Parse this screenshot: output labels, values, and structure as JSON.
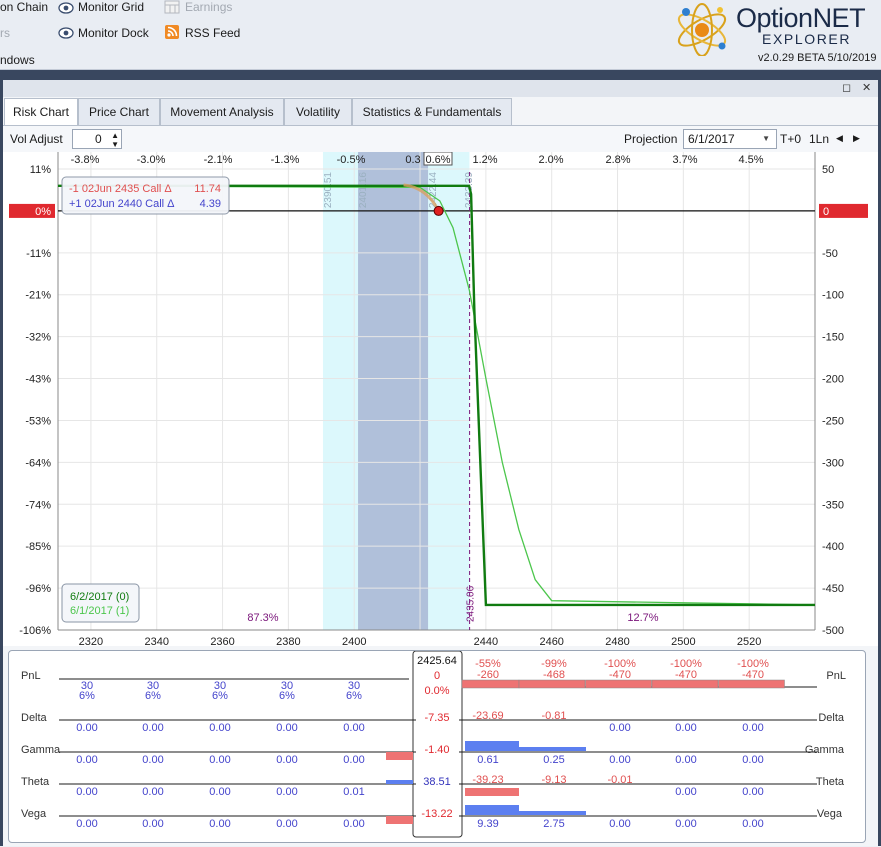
{
  "ribbon": {
    "items": [
      {
        "label": "on Chain",
        "icon": "option-chain-icon",
        "dim": false
      },
      {
        "label": "Monitor Grid",
        "icon": "monitor-grid-icon",
        "dim": false
      },
      {
        "label": "Earnings",
        "icon": "earnings-icon",
        "dim": true
      },
      {
        "label": "rs",
        "icon": "",
        "dim": true
      },
      {
        "label": "Monitor Dock",
        "icon": "monitor-dock-icon",
        "dim": false
      },
      {
        "label": "RSS Feed",
        "icon": "rss-feed-icon",
        "dim": false
      },
      {
        "label": "ndows",
        "icon": "",
        "dim": false
      }
    ],
    "logo": {
      "name_a": "Option",
      "name_b": "NET",
      "name_c": "EXPLORER",
      "version": "v2.0.29 BETA 5/10/2019"
    }
  },
  "window_controls": {
    "restore": "◻",
    "close": "✕"
  },
  "tabs": [
    "Risk Chart",
    "Price Chart",
    "Movement Analysis",
    "Volatility",
    "Statistics & Fundamentals"
  ],
  "toolbar": {
    "vol_adjust_label": "Vol Adjust",
    "vol_adjust_value": "0",
    "projection_label": "Projection",
    "projection_date": "6/1/2017",
    "t_offset": "T+0",
    "lines": "1Ln"
  },
  "colors": {
    "accent_red": "#e0292f",
    "loss_red": "#e05050",
    "gain_blue": "#4444cc",
    "curve_dark_green": "#107b10",
    "curve_light_green": "#4cc64c",
    "band_outer": "#dcf8fc",
    "band_inner": "#b0c0da",
    "sd_label": "#9ab0c0",
    "marker_purple": "#7a157a"
  },
  "chart_data": {
    "type": "line",
    "x_axis": {
      "label": "",
      "min": 2310,
      "max": 2540,
      "ticks": [
        2320,
        2340,
        2360,
        2380,
        2400,
        2420,
        2440,
        2460,
        2480,
        2500,
        2520
      ]
    },
    "top_axis_ticks": [
      "-3.8%",
      "-3.0%",
      "-2.1%",
      "-1.3%",
      "-0.5%",
      "0.3",
      "0.6%",
      "1.2%",
      "2.0%",
      "2.8%",
      "3.7%",
      "4.5%"
    ],
    "top_axis_highlight": "0.6%",
    "left_axis": {
      "ticks": [
        "11%",
        "0%",
        "-11%",
        "-21%",
        "-32%",
        "-43%",
        "-53%",
        "-64%",
        "-74%",
        "-85%",
        "-96%",
        "-106%"
      ]
    },
    "right_axis": {
      "min": -500,
      "max": 50,
      "ticks": [
        "50",
        "0",
        "-50",
        "-100",
        "-150",
        "-200",
        "-250",
        "-300",
        "-350",
        "-400",
        "-450",
        "-500"
      ]
    },
    "zero_label_left": "0%",
    "zero_label_right": "0",
    "sd_bands": {
      "outer": [
        2390.51,
        2435.0
      ],
      "inner": [
        2401.16,
        2422.44
      ],
      "labels": [
        "2390.51",
        "2401.16",
        "2422.44",
        "2433.39"
      ]
    },
    "current_price": 2425.64,
    "break_even": {
      "x": 2435.06,
      "label": "2435.06"
    },
    "prob_left": "87.3%",
    "prob_right": "12.7%",
    "positions": [
      {
        "label": "-1 02Jun 2435 Call  Δ",
        "value": "11.74",
        "color": "#e05050"
      },
      {
        "label": "+1 02Jun 2440 Call  Δ",
        "value": "4.39",
        "color": "#4444cc"
      }
    ],
    "series": [
      {
        "name": "6/2/2017 (0)",
        "color": "#107b10",
        "x": [
          2310,
          2434.9,
          2435.5,
          2436.5,
          2440,
          2540
        ],
        "y": [
          30,
          30,
          20,
          -120,
          -470,
          -470
        ]
      },
      {
        "name": "6/1/2017 (1)",
        "color": "#4cc64c",
        "x": [
          2310,
          2420,
          2426,
          2430,
          2435,
          2440,
          2445,
          2450,
          2455,
          2460,
          2540
        ],
        "y": [
          30,
          28,
          12,
          -20,
          -95,
          -200,
          -300,
          -380,
          -440,
          -465,
          -470
        ]
      }
    ]
  },
  "greeks": {
    "current_label": "2425.64",
    "rows": [
      {
        "name": "PnL",
        "center": "0",
        "center2": "0.0%",
        "center_color": "#e0292f",
        "left_values": [
          "30",
          "30",
          "30",
          "30",
          "30"
        ],
        "left_pcts": [
          "6%",
          "6%",
          "6%",
          "6%",
          "6%"
        ],
        "right_top": [
          "-55%",
          "-99%",
          "-100%",
          "-100%",
          "-100%"
        ],
        "right_values": [
          "-260",
          "-468",
          "-470",
          "-470",
          "-470"
        ]
      },
      {
        "name": "Delta",
        "center": "-7.35",
        "center_color": "#e0292f",
        "left_values": [
          "0.00",
          "0.00",
          "0.00",
          "0.00",
          "0.00"
        ],
        "right_values": [
          "-23.69",
          "-0.81",
          "0.00",
          "0.00",
          "0.00"
        ]
      },
      {
        "name": "Gamma",
        "center": "-1.40",
        "center_color": "#e0292f",
        "left_values": [
          "0.00",
          "0.00",
          "0.00",
          "0.00",
          "0.00"
        ],
        "right_values": [
          "0.61",
          "0.25",
          "0.00",
          "0.00",
          "0.00"
        ]
      },
      {
        "name": "Theta",
        "center": "38.51",
        "center_color": "#3333bb",
        "left_values": [
          "0.00",
          "0.00",
          "0.00",
          "0.00",
          "0.01"
        ],
        "right_values": [
          "-39.23",
          "-9.13",
          "-0.01",
          "0.00",
          "0.00"
        ]
      },
      {
        "name": "Vega",
        "center": "-13.22",
        "center_color": "#e0292f",
        "left_values": [
          "0.00",
          "0.00",
          "0.00",
          "0.00",
          "0.00"
        ],
        "right_values": [
          "9.39",
          "2.75",
          "0.00",
          "0.00",
          "0.00"
        ]
      }
    ]
  }
}
